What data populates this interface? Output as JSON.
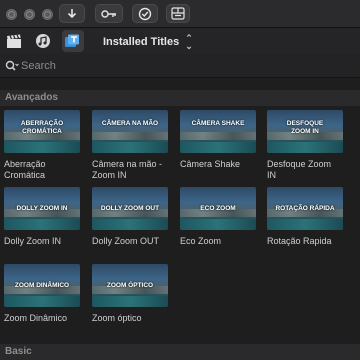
{
  "toolbar": {
    "traffic_lights": [
      "close",
      "minimize",
      "zoom"
    ],
    "buttons": [
      {
        "icon": "download-arrow-icon"
      },
      {
        "icon": "key-icon"
      },
      {
        "icon": "checkmark-circle-icon"
      },
      {
        "icon": "layout-panels-icon"
      }
    ]
  },
  "browser": {
    "tabs": [
      {
        "icon": "clapperboard-icon",
        "active": false
      },
      {
        "icon": "music-notes-icon",
        "active": false
      },
      {
        "icon": "titles-icon",
        "active": true
      }
    ],
    "dropdown_label": "Installed Titles"
  },
  "search": {
    "placeholder": "Search",
    "value": ""
  },
  "sections": [
    {
      "title": "Avançados",
      "items": [
        {
          "thumb_text": "ABERRAÇÃO\nCROMÁTICA",
          "label": "Aberração\nCromática"
        },
        {
          "thumb_text": "CÂMERA NA MÃO",
          "label": "Câmera na mão -\nZoom IN"
        },
        {
          "thumb_text": "CÂMERA SHAKE",
          "label": "Câmera Shake"
        },
        {
          "thumb_text": "DESFOQUE\nZOOM IN",
          "label": "Desfoque Zoom\nIN"
        },
        {
          "thumb_text": "DOLLY ZOOM IN",
          "label": "Dolly Zoom IN"
        },
        {
          "thumb_text": "DOLLY ZOOM OUT",
          "label": "Dolly Zoom OUT"
        },
        {
          "thumb_text": "ECO ZOOM",
          "label": "Eco Zoom"
        },
        {
          "thumb_text": "ROTAÇÃO RÁPIDA",
          "label": "Rotação Rapida"
        },
        {
          "thumb_text": "ZOOM DINÂMICO",
          "label": "Zoom Dinâmico"
        },
        {
          "thumb_text": "ZOOM ÓPTICO",
          "label": "Zoom óptico"
        }
      ]
    },
    {
      "title": "Basic",
      "items": []
    }
  ],
  "colors": {
    "background": "#1e1e1f",
    "toolbar": "#2b2b2d",
    "section_header": "#2a2a2c",
    "text": "#d0d0d2",
    "muted": "#8e8e90"
  }
}
